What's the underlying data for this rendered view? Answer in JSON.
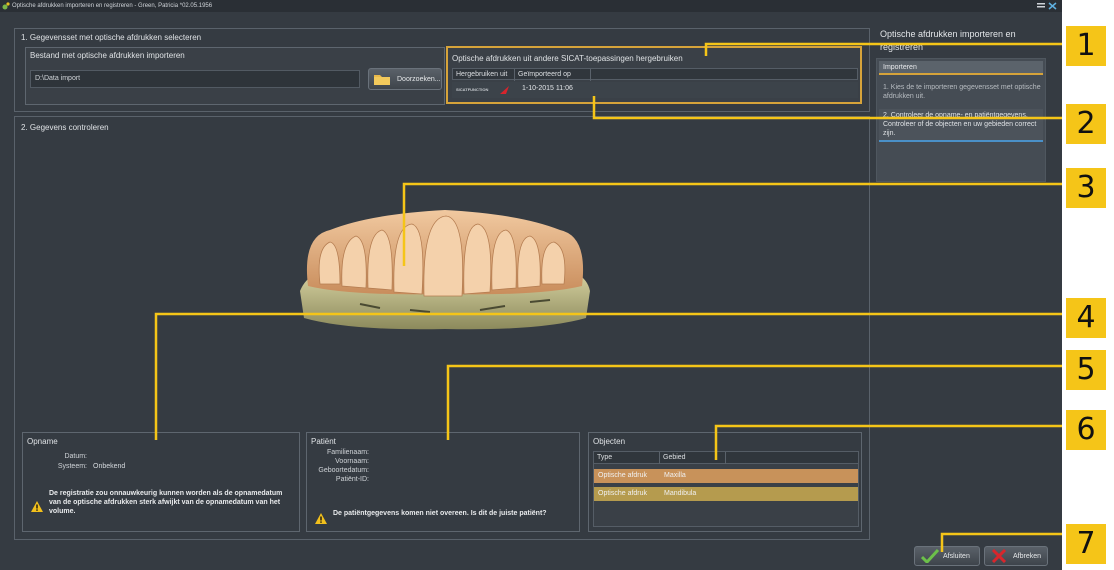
{
  "window": {
    "title": "Optische afdrukken importeren en registreren - Green, Patricia *02.05.1956"
  },
  "section1": {
    "title": "1. Gegevensset met optische afdrukken selecteren",
    "file_box_title": "Bestand met optische afdrukken importeren",
    "path_value": "D:\\Data import",
    "browse_label": "Doorzoeken...",
    "reuse_title": "Optische afdrukken uit andere SICAT-toepassingen hergebruiken",
    "reuse_headers": [
      "Hergebruiken uit",
      "Geïmporteerd op"
    ],
    "reuse_row": {
      "source_logo": "SICATFUNCTION",
      "date": "1-10-2015 11:06"
    }
  },
  "section2": {
    "title": "2. Gegevens controleren"
  },
  "opname": {
    "title": "Opname",
    "datum_label": "Datum:",
    "systeem_label": "Systeem:",
    "systeem_value": "Onbekend",
    "warning": "De registratie zou onnauwkeurig kunnen worden als de opnamedatum van de optische afdrukken sterk afwijkt van de opnamedatum van het volume."
  },
  "patient": {
    "title": "Patiënt",
    "labels": [
      "Familienaam:",
      "Voornaam:",
      "Geboortedatum:",
      "Patiënt-ID:"
    ],
    "warning": "De patiëntgegevens komen niet overeen. Is dit de juiste patiënt?"
  },
  "objecten": {
    "title": "Objecten",
    "headers": [
      "Type",
      "Gebied"
    ],
    "rows": [
      {
        "type": "Optische afdruk",
        "gebied": "Maxilla"
      },
      {
        "type": "Optische afdruk",
        "gebied": "Mandibula"
      }
    ]
  },
  "sidebar": {
    "title": "Optische afdrukken importeren en registreren",
    "tab": "Importeren",
    "step1": "1. Kies de te importeren gegevensset met optische afdrukken uit.",
    "step2": "2. Controleer de opname- en patiëntgegevens. Controleer of de objecten en uw gebieden correct zijn."
  },
  "buttons": {
    "finish": "Afsluiten",
    "cancel": "Afbreken"
  },
  "callouts": [
    "1",
    "2",
    "3",
    "4",
    "5",
    "6",
    "7"
  ],
  "colors": {
    "highlight": "#d6a33a",
    "maxilla_row": "#c8925a",
    "mandibula_row": "#b59b4e",
    "callout": "#f5c518"
  }
}
